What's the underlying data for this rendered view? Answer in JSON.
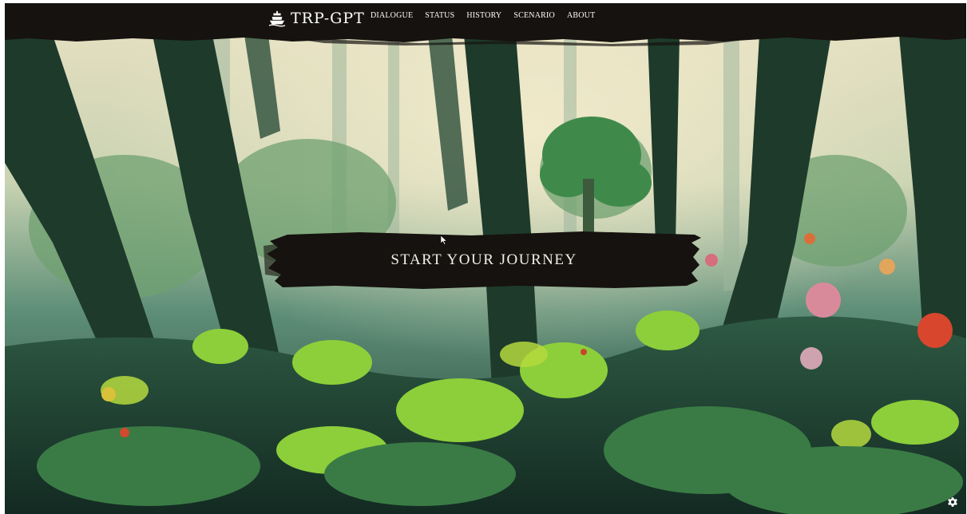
{
  "app": {
    "brand_name": "TRP-GPT",
    "brand_icon": "ship-icon"
  },
  "nav": {
    "items": [
      {
        "label": "DIALOGUE"
      },
      {
        "label": "STATUS"
      },
      {
        "label": "HISTORY"
      },
      {
        "label": "SCENARIO"
      },
      {
        "label": "ABOUT"
      }
    ]
  },
  "hero": {
    "cta_label": "START YOUR JOURNEY",
    "background": "forest-painting-image"
  },
  "footer": {
    "settings_icon": "gear-icon"
  },
  "colors": {
    "bar": "#15120f",
    "text": "#ffffff",
    "sky": "#e9e2c4",
    "forest_dark": "#1e3a2e",
    "foliage": "#8ccf3a"
  }
}
